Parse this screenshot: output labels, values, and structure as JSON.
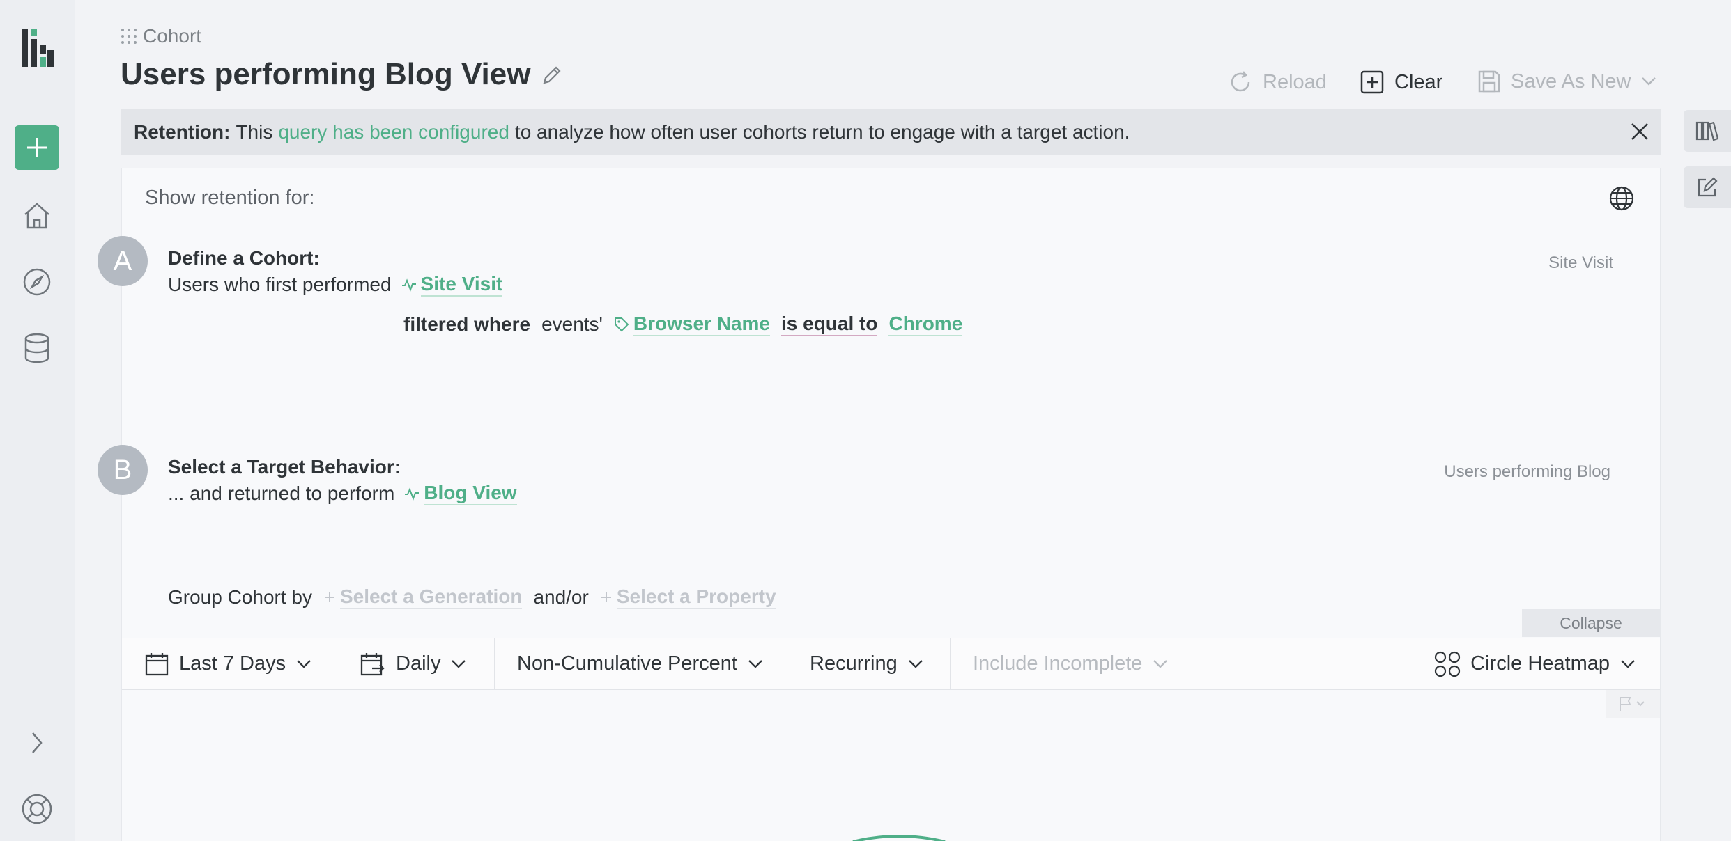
{
  "breadcrumb": {
    "label": "Cohort"
  },
  "page": {
    "title": "Users performing Blog View"
  },
  "header_actions": {
    "reload": "Reload",
    "clear": "Clear",
    "save_as_new": "Save As New"
  },
  "banner": {
    "bold": "Retention:",
    "pre": "This",
    "link": "query has been configured",
    "post": "to analyze how often user cohorts return to engage with a target action."
  },
  "card": {
    "show_label": "Show retention for:",
    "section_a": {
      "badge": "A",
      "title": "Define a Cohort:",
      "text": "Users who first performed",
      "event": "Site Visit",
      "filter_label": "filtered where",
      "filter_scope": "events'",
      "property": "Browser Name",
      "operator": "is equal to",
      "value": "Chrome",
      "aside": "Site Visit"
    },
    "section_b": {
      "badge": "B",
      "title": "Select a Target Behavior:",
      "text": "... and returned to perform",
      "event": "Blog View",
      "aside": "Users performing Blog"
    },
    "group": {
      "label": "Group Cohort by",
      "generation": "Select a Generation",
      "joiner": "and/or",
      "property": "Select a Property"
    },
    "collapse": "Collapse"
  },
  "toolbar": {
    "date_range": "Last 7 Days",
    "interval": "Daily",
    "measure": "Non-Cumulative Percent",
    "mode": "Recurring",
    "incomplete": "Include Incomplete",
    "viz": "Circle Heatmap"
  },
  "colors": {
    "accent": "#4faf88",
    "badge": "#b4bac2",
    "banner": "#e3e5e9"
  }
}
